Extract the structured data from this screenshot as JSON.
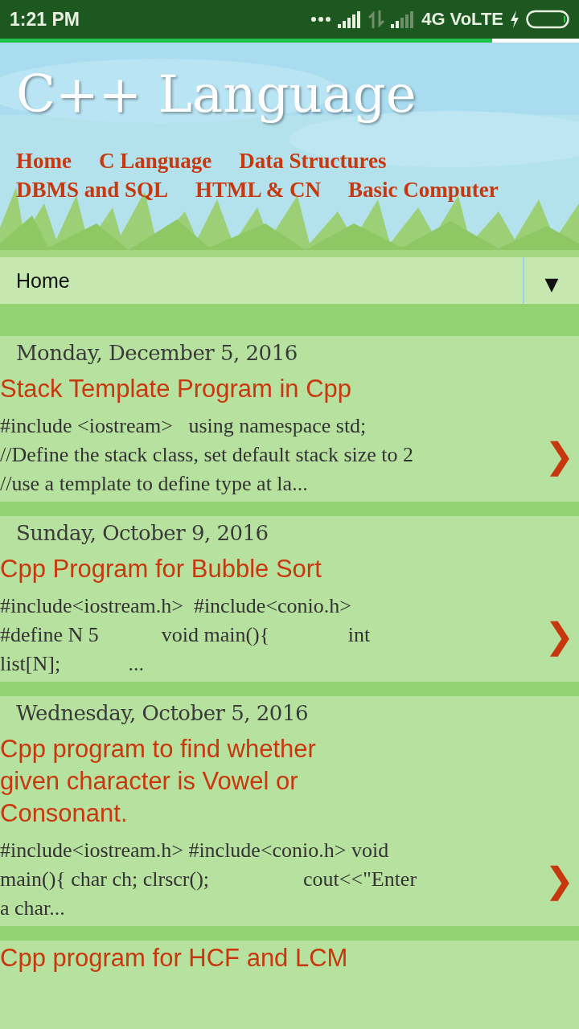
{
  "status_bar": {
    "time": "1:21 PM",
    "network": "4G VoLTE"
  },
  "page_load": {
    "level": 0.85
  },
  "header": {
    "title": "C++ Language",
    "nav": [
      {
        "label": "Home"
      },
      {
        "label": "C Language"
      },
      {
        "label": "Data Structures"
      },
      {
        "label": "DBMS and SQL"
      },
      {
        "label": "HTML & CN"
      },
      {
        "label": "Basic Computer"
      }
    ]
  },
  "page_select": {
    "value": "Home",
    "arrow": "▼"
  },
  "posts": [
    {
      "date": "Monday, December 5, 2016",
      "title": "Stack Template Program in Cpp",
      "snippet": "#include <iostream>   using namespace std;\n//Define the stack class, set default stack size to 2\n//use a template to define type at la...",
      "chevron": "❯"
    },
    {
      "date": "Sunday, October 9, 2016",
      "title": "Cpp Program for Bubble Sort",
      "snippet": "#include<iostream.h>  #include<conio.h>\n#define N 5            void main(){               int\nlist[N];             ...",
      "chevron": "❯"
    },
    {
      "date": "Wednesday, October 5, 2016",
      "title": "Cpp program to find whether\ngiven character is Vowel or\nConsonant.",
      "snippet": "#include<iostream.h> #include<conio.h> void\nmain(){ char ch; clrscr();                  cout<<\"Enter\na char...",
      "chevron": "❯"
    },
    {
      "title": "Cpp program for HCF and LCM"
    }
  ]
}
